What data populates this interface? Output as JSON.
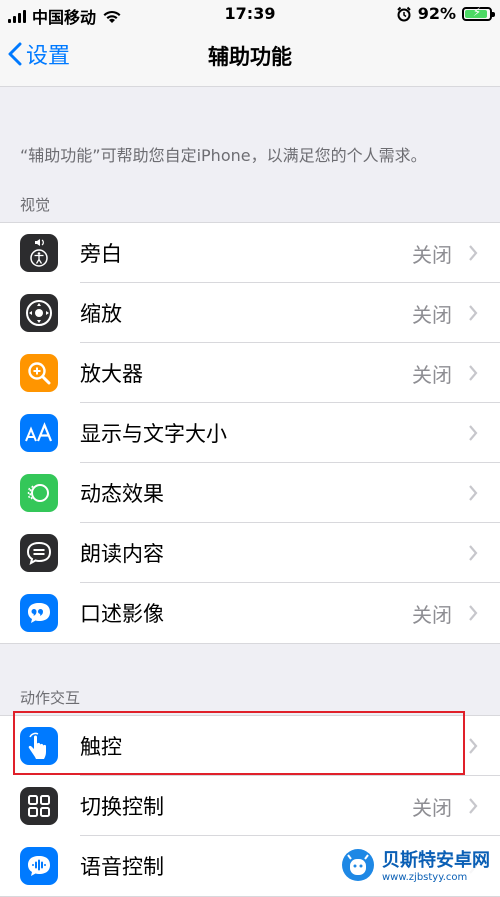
{
  "status_bar": {
    "carrier": "中国移动",
    "time": "17:39",
    "battery": "92%",
    "battery_level": 0.92
  },
  "nav": {
    "back_label": "设置",
    "title": "辅助功能"
  },
  "description": "“辅助功能”可帮助您自定iPhone，以满足您的个人需求。",
  "sections": {
    "vision": {
      "header": "视觉",
      "items": [
        {
          "label": "旁白",
          "value": "关闭",
          "icon": "voiceover-icon",
          "color": "#1c1c1e"
        },
        {
          "label": "缩放",
          "value": "关闭",
          "icon": "zoom-icon",
          "color": "#1c1c1e"
        },
        {
          "label": "放大器",
          "value": "关闭",
          "icon": "magnifier-icon",
          "color": "#ff9500"
        },
        {
          "label": "显示与文字大小",
          "value": "",
          "icon": "text-size-icon",
          "color": "#007aff"
        },
        {
          "label": "动态效果",
          "value": "",
          "icon": "motion-icon",
          "color": "#34c759"
        },
        {
          "label": "朗读内容",
          "value": "",
          "icon": "spoken-content-icon",
          "color": "#1c1c1e"
        },
        {
          "label": "口述影像",
          "value": "关闭",
          "icon": "audio-description-icon",
          "color": "#007aff"
        }
      ]
    },
    "interaction": {
      "header": "动作交互",
      "items": [
        {
          "label": "触控",
          "value": "",
          "icon": "touch-icon",
          "color": "#007aff"
        },
        {
          "label": "切换控制",
          "value": "关闭",
          "icon": "switch-control-icon",
          "color": "#1c1c1e"
        },
        {
          "label": "语音控制",
          "value": "",
          "icon": "voice-control-icon",
          "color": "#007aff"
        }
      ]
    }
  },
  "watermark": {
    "name": "贝斯特安卓网",
    "url": "www.zjbstyy.com"
  }
}
